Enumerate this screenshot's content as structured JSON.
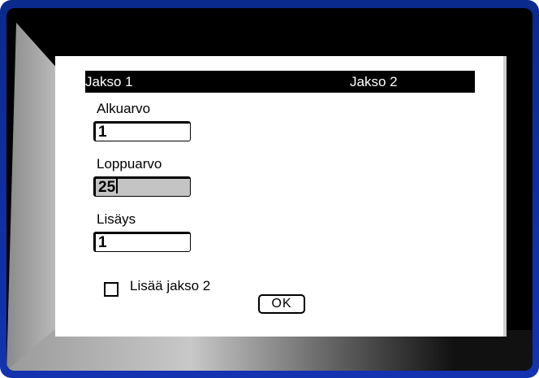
{
  "dialog": {
    "sections": [
      "Jakso 1",
      "Jakso 2"
    ],
    "fields": [
      {
        "label": "Alkuarvo",
        "value": "1"
      },
      {
        "label": "Loppuarvo",
        "value": "25"
      },
      {
        "label": "Lisäys",
        "value": "1"
      }
    ],
    "checkbox": {
      "label": "Lisää jakso 2",
      "checked": false
    },
    "ok_label": "OK"
  }
}
